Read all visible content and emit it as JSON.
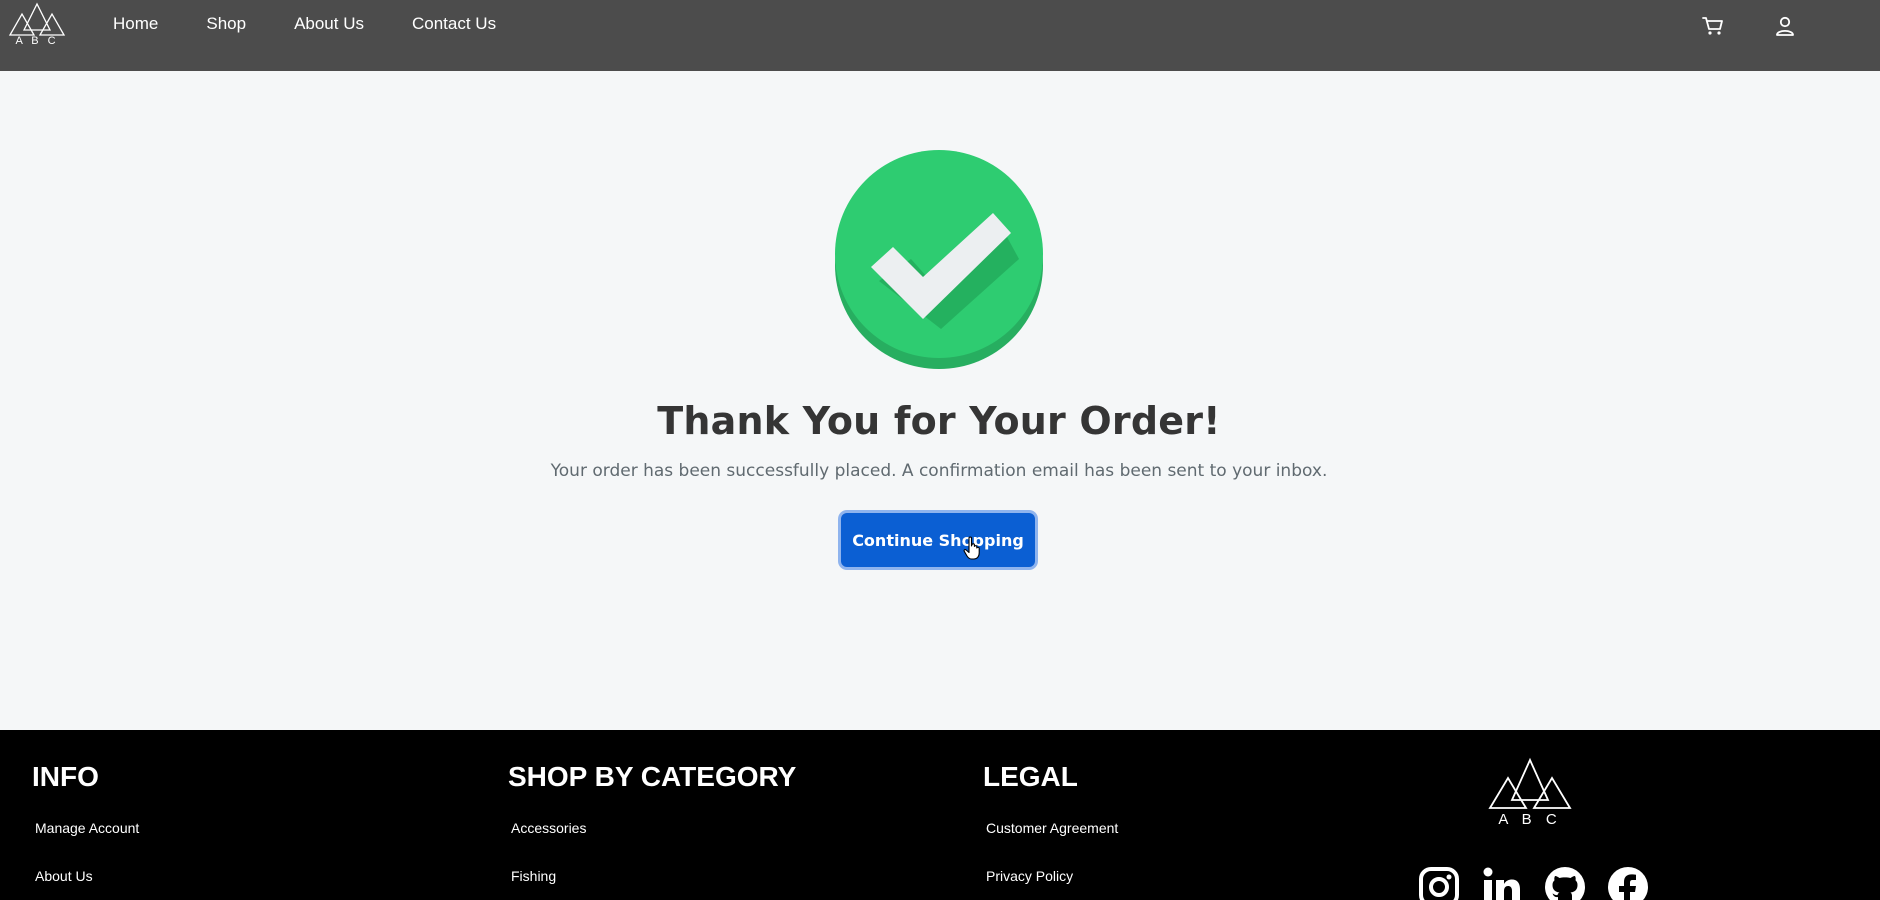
{
  "header": {
    "logo_letters": "A B C",
    "nav": [
      "Home",
      "Shop",
      "About Us",
      "Contact Us"
    ],
    "icons": [
      "cart-icon",
      "user-icon"
    ]
  },
  "main": {
    "status_icon": "check-circle-icon",
    "title": "Thank You for Your Order!",
    "message": "Your order has been successfully placed. A confirmation email has been sent to your inbox.",
    "button_label": "Continue Shopping",
    "accent_color": "#0b5fd3",
    "success_color": "#2ecc71"
  },
  "footer": {
    "columns": [
      {
        "heading": "INFO",
        "links": [
          "Manage Account",
          "About Us"
        ]
      },
      {
        "heading": "SHOP BY CATEGORY",
        "links": [
          "Accessories",
          "Fishing"
        ]
      },
      {
        "heading": "LEGAL",
        "links": [
          "Customer Agreement",
          "Privacy Policy"
        ]
      }
    ],
    "logo_letters": "A B C",
    "social": [
      "instagram-icon",
      "linkedin-icon",
      "github-icon",
      "facebook-icon"
    ]
  }
}
